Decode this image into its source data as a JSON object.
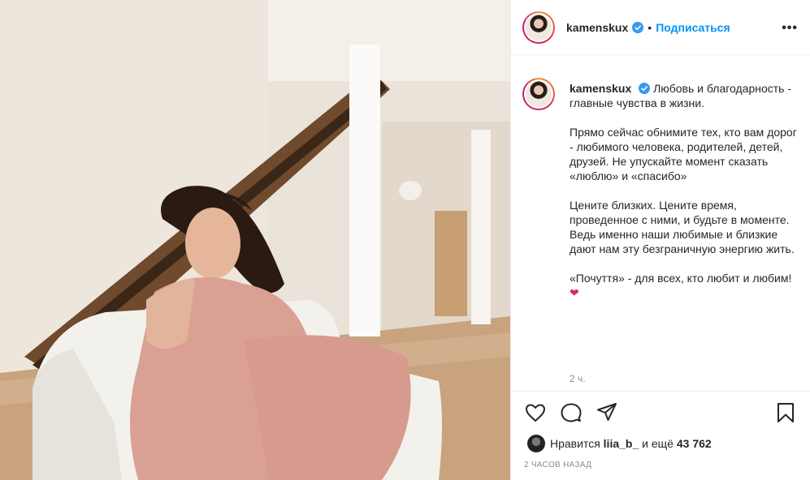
{
  "post": {
    "username": "kamenskux",
    "dot": "•",
    "follow_label": "Подписаться",
    "more_label": "•••",
    "caption": {
      "username": "kamenskux",
      "p1": "Любовь и благодарность - главные чувства в жизни.",
      "p2": "Прямо сейчас обнимите тех, кто вам дорог - любимого человека, родителей, детей, друзей. Не упускайте момент сказать «люблю» и «спасибо»",
      "p3": "Цените близких. Цените время, проведенное с ними, и будьте в моменте. Ведь именно наши любимые и близкие дают нам эту безграничную энергию жить.",
      "p4": "«Почуття» - для всех, кто любит и любим!",
      "emoji": "❤",
      "age": "2 ч."
    },
    "likes": {
      "prefix": "Нравится",
      "user": "liia_b_",
      "middle": "и ещё",
      "count": "43 762"
    },
    "time_ago": "2 ЧАСОВ НАЗАД"
  },
  "icons": {
    "like": "heart-icon",
    "comment": "comment-icon",
    "share": "share-icon",
    "save": "bookmark-icon",
    "verified": "verified-badge-icon"
  },
  "colors": {
    "accent": "#0095f6",
    "verified": "#3897f0",
    "emoji_heart": "#e0245e",
    "muted": "#8e8e8e"
  }
}
